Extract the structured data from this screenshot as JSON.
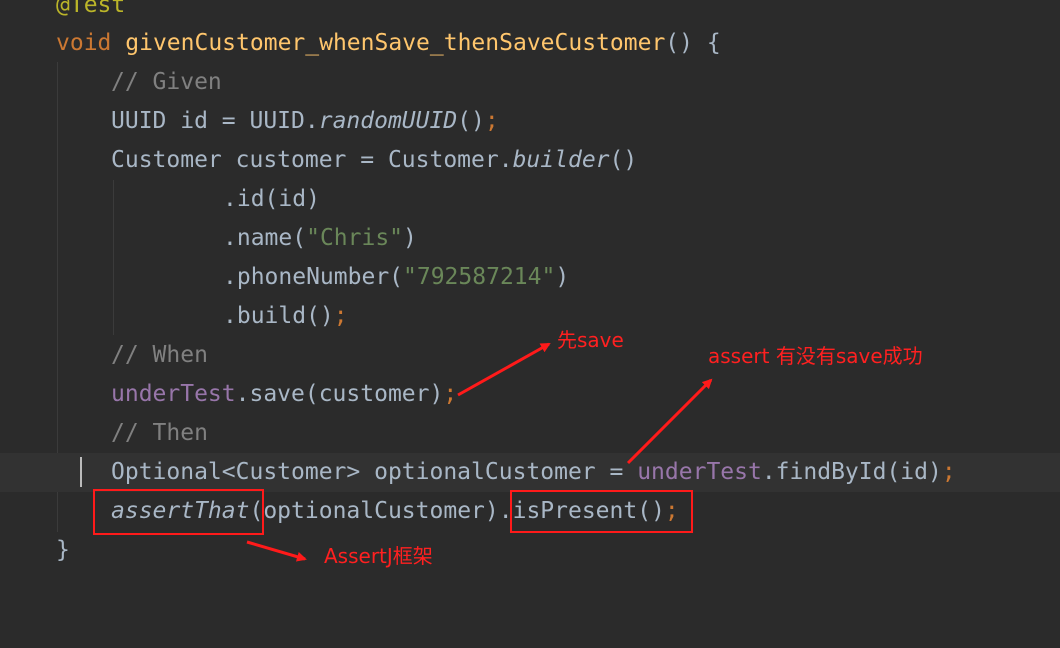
{
  "code": {
    "annotation_line": "@Test",
    "method_keyword": "void",
    "method_name": "givenCustomer_whenSave_thenSaveCustomer",
    "method_open": "() {",
    "comment_given": "// Given",
    "uuid_type": "UUID id = UUID.",
    "uuid_call": "randomUUID",
    "uuid_paren": "()",
    "customer_decl": "Customer customer = Customer.",
    "builder_call": "builder",
    "builder_paren": "()",
    "id_call": ".id(id)",
    "name_call_open": ".name(",
    "name_value": "\"Chris\"",
    "name_call_close": ")",
    "phone_call_open": ".phoneNumber(",
    "phone_value": "\"792587214\"",
    "phone_call_close": ")",
    "build_call": ".build()",
    "comment_when": "// When",
    "under_test": "underTest",
    "save_call": ".save(customer)",
    "comment_then": "// Then",
    "optional_decl": "Optional<Customer> optionalCustomer = ",
    "under_test_2": "underTest",
    "find_call": ".findById(id)",
    "assert_that": "assertThat",
    "assert_args": "(optionalCustomer).",
    "is_present": "isPresent()",
    "semicolon": ";",
    "closing_brace": "}"
  },
  "notes": {
    "save_note": "先save",
    "assert_note": "assert 有没有save成功",
    "assertj_note": "AssertJ框架"
  },
  "colors": {
    "annotation_red": "#ff1a1a",
    "background": "#2b2b2b"
  }
}
